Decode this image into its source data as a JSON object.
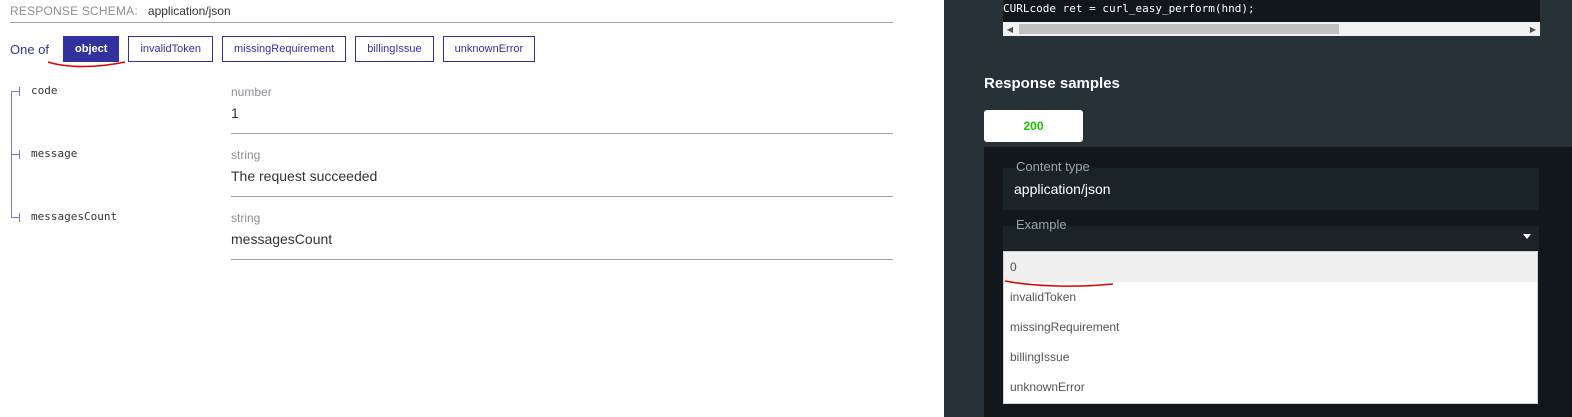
{
  "schema": {
    "header_label": "RESPONSE SCHEMA:",
    "content_type": "application/json",
    "one_of_label": "One of",
    "variants": [
      "object",
      "invalidToken",
      "missingRequirement",
      "billingIssue",
      "unknownError"
    ],
    "active_variant": "object",
    "properties": [
      {
        "name": "code",
        "type": "number",
        "value": "1"
      },
      {
        "name": "message",
        "type": "string",
        "value": "The request succeeded"
      },
      {
        "name": "messagesCount",
        "type": "string",
        "value": "messagesCount"
      }
    ]
  },
  "code_sample": {
    "line": "CURLcode ret = curl_easy_perform(hnd);"
  },
  "responses": {
    "title": "Response samples",
    "status_tab": "200",
    "content_type_label": "Content type",
    "content_type_value": "application/json",
    "example_label": "Example",
    "example_options": [
      "0",
      "invalidToken",
      "missingRequirement",
      "billingIssue",
      "unknownError"
    ],
    "selected_example": "0"
  },
  "colors": {
    "accent": "#32329f",
    "right_panel_bg": "#263238",
    "success": "#1fc400",
    "annotation": "#e00000"
  }
}
